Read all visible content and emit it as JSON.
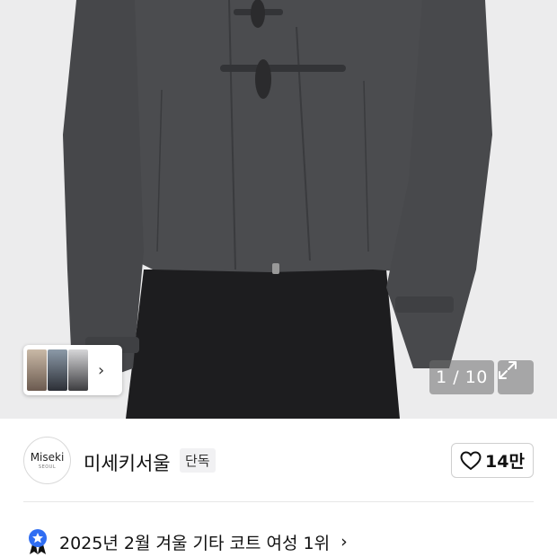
{
  "gallery": {
    "counter": "1 / 10",
    "thumbnail_next_icon": "chevron-right-icon",
    "expand_icon": "expand-icon"
  },
  "brand": {
    "logo_text": "Miseki",
    "logo_subtext": "SEOUL",
    "name": "미세키서울",
    "badge": "단독"
  },
  "like": {
    "icon": "heart-icon",
    "count": "14만"
  },
  "ranking": {
    "icon": "ranking-badge-icon",
    "text": "2025년 2월 겨울 기타 코트 여성 1위",
    "arrow_icon": "chevron-right-icon"
  }
}
